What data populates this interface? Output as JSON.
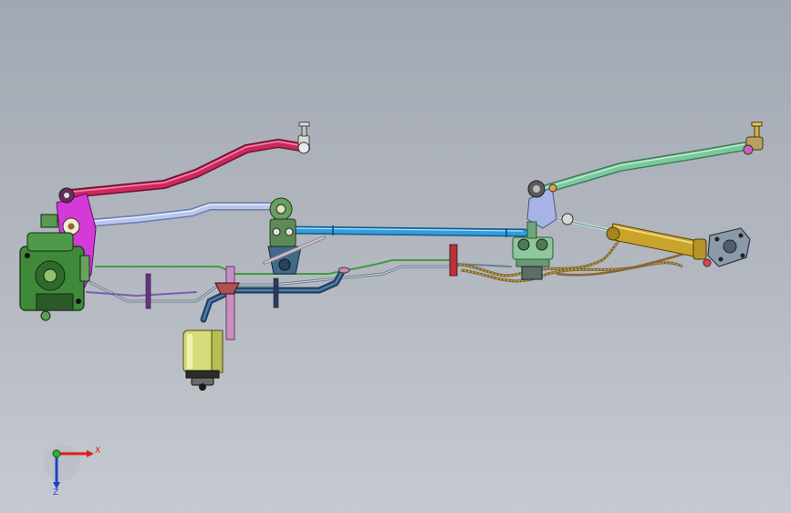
{
  "triad": {
    "x_label": "X",
    "z_label": "Z",
    "x_color": "#e01c1c",
    "y_color": "#2fb02f",
    "z_color": "#1f3fc8"
  },
  "colors": {
    "background_top": "#a2a8b2",
    "background_bottom": "#c6cad0",
    "drag_link": "#cc2a5c",
    "upper_tie_rod": "#b9c7ee",
    "lower_tie_rod": "#2f9fe0",
    "right_tie_rod": "#7cc89a",
    "steering_gear": "#3f8a3a",
    "pitman_arm": "#d43ad8",
    "reservoir": "#d7dc78",
    "power_cylinder": "#c9a42a",
    "hydraulic_line": "#3a6c9a"
  }
}
